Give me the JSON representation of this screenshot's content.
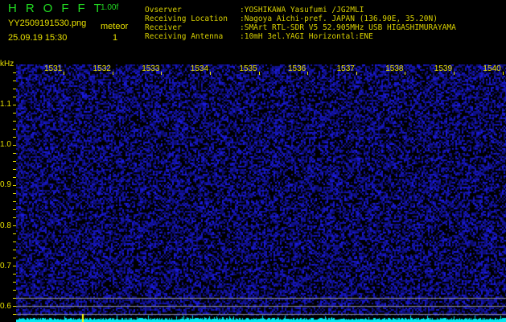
{
  "header": {
    "title": "HROFFT",
    "version": "1.00f",
    "filename": "YY2509191530.png",
    "datetime": "25.09.19 15:30",
    "meteor_label": "meteor",
    "meteor_count": "1"
  },
  "info": [
    {
      "key": "Ovserver",
      "value": ":YOSHIKAWA Yasufumi /JG2MLI"
    },
    {
      "key": "Receiving Location",
      "value": ":Nagoya Aichi-pref. JAPAN (136.90E, 35.20N)"
    },
    {
      "key": "Receiver",
      "value": ":SMArt RTL-SDR V5 52.905MHz USB HIGASHIMURAYAMA"
    },
    {
      "key": "Receiving Antenna",
      "value": ":10mH 3el.YAGI Horizontal:ENE"
    }
  ],
  "axis": {
    "unit": "kHz",
    "y_labels": [
      "1.1",
      "1.0",
      "0.9",
      "0.8",
      "0.7",
      "0.6"
    ],
    "x_labels": [
      "1531",
      "1532",
      "1533",
      "1534",
      "1535",
      "1536",
      "1537",
      "1538",
      "1539",
      "1540"
    ]
  },
  "colors": {
    "background": "#000000",
    "noise": "#1010a0",
    "level": "#00e8f0",
    "marker": "#ffff00",
    "text": "#e8e000"
  }
}
